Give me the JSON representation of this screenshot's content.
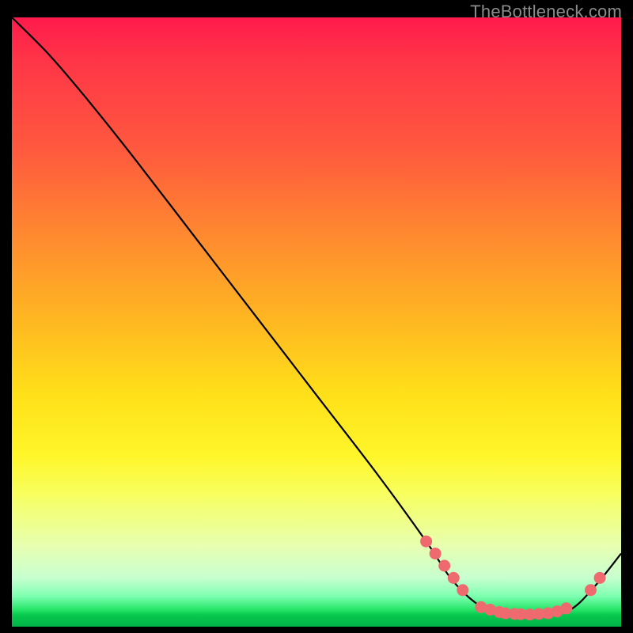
{
  "watermark": "TheBottleneck.com",
  "chart_data": {
    "type": "line",
    "title": "",
    "xlabel": "",
    "ylabel": "",
    "xlim": [
      0,
      100
    ],
    "ylim": [
      0,
      100
    ],
    "grid": false,
    "legend": false,
    "series": [
      {
        "name": "bottleneck-curve",
        "x": [
          0,
          6,
          12,
          20,
          30,
          40,
          50,
          60,
          68,
          72,
          76,
          80,
          84,
          88,
          92,
          96,
          100
        ],
        "y": [
          100,
          94,
          87,
          77,
          64,
          51,
          38,
          25,
          14,
          8,
          4,
          2,
          2,
          2,
          3,
          7,
          12
        ]
      }
    ],
    "marker_clusters": [
      {
        "name": "descending-tail-markers",
        "points": [
          {
            "x": 68,
            "y": 14
          },
          {
            "x": 69.5,
            "y": 12
          },
          {
            "x": 71,
            "y": 10
          },
          {
            "x": 72.5,
            "y": 8
          },
          {
            "x": 74,
            "y": 6
          }
        ]
      },
      {
        "name": "valley-floor-markers",
        "points": [
          {
            "x": 77,
            "y": 3.2
          },
          {
            "x": 78.5,
            "y": 2.8
          },
          {
            "x": 80,
            "y": 2.4
          },
          {
            "x": 81,
            "y": 2.2
          },
          {
            "x": 82.5,
            "y": 2.1
          },
          {
            "x": 83.5,
            "y": 2.05
          },
          {
            "x": 85,
            "y": 2.0
          },
          {
            "x": 86.5,
            "y": 2.1
          },
          {
            "x": 88,
            "y": 2.2
          },
          {
            "x": 89.5,
            "y": 2.5
          },
          {
            "x": 91,
            "y": 3.0
          }
        ]
      },
      {
        "name": "rising-tail-markers",
        "points": [
          {
            "x": 95,
            "y": 6
          },
          {
            "x": 96.5,
            "y": 8
          }
        ]
      }
    ],
    "colors": {
      "curve": "#000000",
      "markers": "#ef6a6f",
      "gradient_top": "#ff1a4c",
      "gradient_mid": "#ffe019",
      "gradient_bottom": "#00b347"
    }
  }
}
